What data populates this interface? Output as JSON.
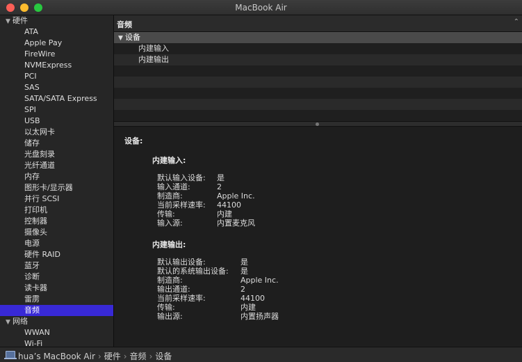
{
  "window": {
    "title": "MacBook Air"
  },
  "sidebar": {
    "groups": [
      {
        "label": "硬件",
        "expanded": true,
        "items": [
          "ATA",
          "Apple Pay",
          "FireWire",
          "NVMExpress",
          "PCI",
          "SAS",
          "SATA/SATA Express",
          "SPI",
          "USB",
          "以太网卡",
          "储存",
          "光盘刻录",
          "光纤通道",
          "内存",
          "图形卡/显示器",
          "并行 SCSI",
          "打印机",
          "控制器",
          "摄像头",
          "电源",
          "硬件 RAID",
          "蓝牙",
          "诊断",
          "读卡器",
          "雷雳",
          "音频"
        ]
      },
      {
        "label": "网络",
        "expanded": true,
        "items": [
          "WWAN",
          "Wi-Fi"
        ]
      }
    ],
    "selected": "音频"
  },
  "main": {
    "column_header": "音频",
    "tree": {
      "root": "设备",
      "children": [
        "内建输入",
        "内建输出"
      ]
    },
    "detail": {
      "title": "设备:",
      "input": {
        "heading": "内建输入:",
        "rows": [
          {
            "key": "默认输入设备:",
            "value": "是"
          },
          {
            "key": "输入通道:",
            "value": "2"
          },
          {
            "key": "制造商:",
            "value": "Apple Inc."
          },
          {
            "key": "当前采样速率:",
            "value": "44100"
          },
          {
            "key": "传输:",
            "value": "内建"
          },
          {
            "key": "输入源:",
            "value": "内置麦克风"
          }
        ]
      },
      "output": {
        "heading": "内建输出:",
        "rows": [
          {
            "key": "默认输出设备:",
            "value": "是"
          },
          {
            "key": "默认的系统输出设备:",
            "value": "是"
          },
          {
            "key": "制造商:",
            "value": "Apple Inc."
          },
          {
            "key": "输出通道:",
            "value": "2"
          },
          {
            "key": "当前采样速率:",
            "value": "44100"
          },
          {
            "key": "传输:",
            "value": "内建"
          },
          {
            "key": "输出源:",
            "value": "内置扬声器"
          }
        ]
      }
    }
  },
  "statusbar": {
    "path": [
      "hua’s MacBook Air",
      "硬件",
      "音频",
      "设备"
    ]
  },
  "colors": {
    "selection": "#3829d6",
    "background": "#1e1e1e"
  }
}
